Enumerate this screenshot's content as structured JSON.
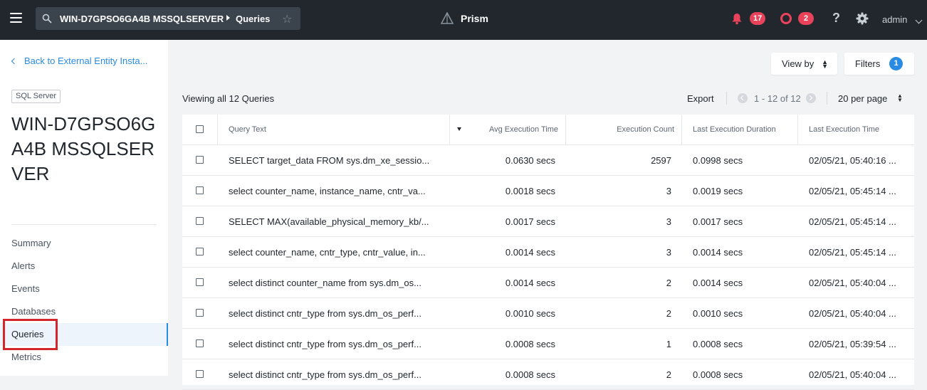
{
  "topbar": {
    "crumb_entity": "WIN-D7GPSO6GA4B MSSQLSERVER",
    "crumb_page": "Queries",
    "app_name": "Prism",
    "alerts_count": "17",
    "events_count": "2",
    "help_label": "?",
    "user": "admin",
    "icons": [
      "menu-icon",
      "search-icon",
      "star-icon",
      "prism-logo",
      "bell-icon",
      "events-ring-icon",
      "help-icon",
      "gear-icon",
      "chevron-down-icon"
    ],
    "colors": {
      "bar_bg": "#22272e",
      "badge": "#e8435a",
      "accent": "#2a8be2"
    }
  },
  "sidebar": {
    "back_label": "Back to External Entity Insta...",
    "type_tag": "SQL Server",
    "title": "WIN-D7GPSO6GA4B MSSQLSERVER",
    "nav": [
      {
        "label": "Summary"
      },
      {
        "label": "Alerts"
      },
      {
        "label": "Events"
      },
      {
        "label": "Databases"
      },
      {
        "label": "Queries",
        "active": true
      },
      {
        "label": "Metrics"
      }
    ]
  },
  "toolbar": {
    "view_by": "View by",
    "filters": "Filters",
    "filters_count": "1",
    "viewing": "Viewing all 12 Queries",
    "export": "Export",
    "pagination": "1 - 12 of 12",
    "per_page": "20 per page"
  },
  "table": {
    "columns": [
      "Query Text",
      "Avg Execution Time",
      "Execution Count",
      "Last Execution Duration",
      "Last Execution Time"
    ],
    "sorted_column": "Avg Execution Time",
    "rows": [
      {
        "query": "SELECT target_data FROM sys.dm_xe_sessio...",
        "avg": "0.0630 secs",
        "count": "2597",
        "duration": "0.0998 secs",
        "last": "02/05/21, 05:40:16 ..."
      },
      {
        "query": "select counter_name, instance_name, cntr_va...",
        "avg": "0.0018 secs",
        "count": "3",
        "duration": "0.0019 secs",
        "last": "02/05/21, 05:45:14 ..."
      },
      {
        "query": "SELECT MAX(available_physical_memory_kb/...",
        "avg": "0.0017 secs",
        "count": "3",
        "duration": "0.0017 secs",
        "last": "02/05/21, 05:45:14 ..."
      },
      {
        "query": "select counter_name, cntr_type, cntr_value, in...",
        "avg": "0.0014 secs",
        "count": "3",
        "duration": "0.0014 secs",
        "last": "02/05/21, 05:45:14 ..."
      },
      {
        "query": "select distinct counter_name from sys.dm_os...",
        "avg": "0.0014 secs",
        "count": "2",
        "duration": "0.0014 secs",
        "last": "02/05/21, 05:40:04 ..."
      },
      {
        "query": "select distinct cntr_type from sys.dm_os_perf...",
        "avg": "0.0010 secs",
        "count": "2",
        "duration": "0.0010 secs",
        "last": "02/05/21, 05:40:04 ..."
      },
      {
        "query": "select distinct cntr_type from sys.dm_os_perf...",
        "avg": "0.0008 secs",
        "count": "1",
        "duration": "0.0008 secs",
        "last": "02/05/21, 05:39:54 ..."
      },
      {
        "query": "select distinct cntr_type from sys.dm_os_perf...",
        "avg": "0.0008 secs",
        "count": "2",
        "duration": "0.0008 secs",
        "last": "02/05/21, 05:40:04 ..."
      }
    ]
  }
}
